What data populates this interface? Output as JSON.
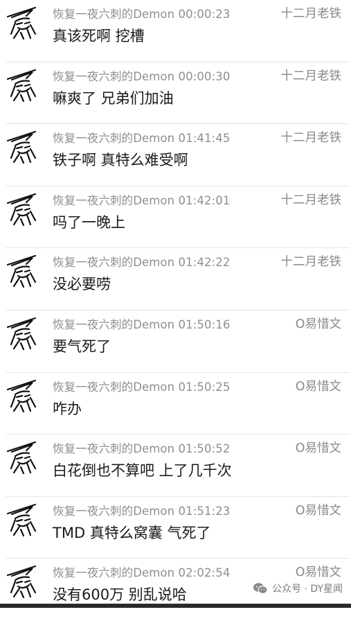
{
  "comments": [
    {
      "meta": "恢复一夜六刺的Demon 00:00:23",
      "author": "十二月老铁",
      "message": "真该死啊 挖槽"
    },
    {
      "meta": "恢复一夜六刺的Demon 00:00:30",
      "author": "十二月老铁",
      "message": "嘛爽了 兄弟们加油"
    },
    {
      "meta": "恢复一夜六刺的Demon 01:41:45",
      "author": "十二月老铁",
      "message": "铁子啊 真特么难受啊"
    },
    {
      "meta": "恢复一夜六刺的Demon 01:42:01",
      "author": "十二月老铁",
      "message": "吗了一晚上"
    },
    {
      "meta": "恢复一夜六刺的Demon 01:42:22",
      "author": "十二月老铁",
      "message": "没必要唠"
    },
    {
      "meta": "恢复一夜六刺的Demon 01:50:16",
      "author": "O易惜文",
      "message": "要气死了"
    },
    {
      "meta": "恢复一夜六刺的Demon 01:50:25",
      "author": "O易惜文",
      "message": "咋办"
    },
    {
      "meta": "恢复一夜六刺的Demon 01:50:52",
      "author": "O易惜文",
      "message": "白花倒也不算吧 上了几千次"
    },
    {
      "meta": "恢复一夜六刺的Demon 01:51:23",
      "author": "O易惜文",
      "message": "TMD 真特么窝囊 气死了"
    },
    {
      "meta": "恢复一夜六刺的Demon 02:02:54",
      "author": "O易惜文",
      "message": "没有600万 别乱说哈"
    }
  ],
  "watermark": {
    "text": "公众号 · DY星闻",
    "icon": "wechat-icon"
  }
}
